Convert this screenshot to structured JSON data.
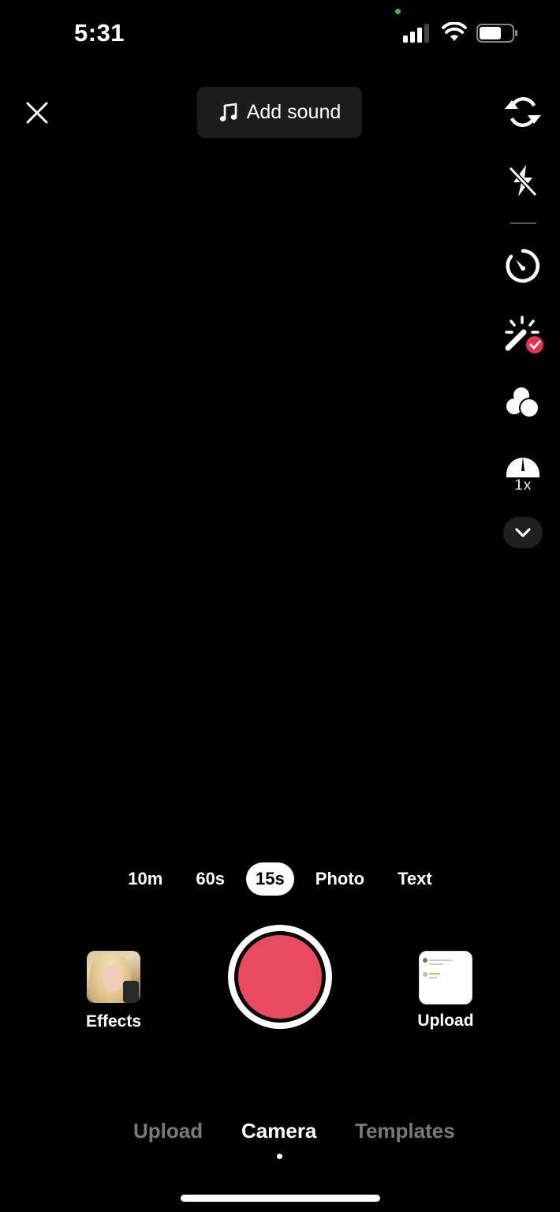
{
  "status_bar": {
    "time": "5:31",
    "icons": [
      "camera-in-use-indicator",
      "cellular-signal-icon",
      "wifi-icon",
      "battery-icon"
    ]
  },
  "top_bar": {
    "close_icon": "close-icon",
    "add_sound": {
      "icon": "music-note-icon",
      "label": "Add sound"
    }
  },
  "right_rail": {
    "items": [
      {
        "name": "flip-camera",
        "icon": "flip-camera-icon"
      },
      {
        "name": "flash-off",
        "icon": "flash-off-icon"
      },
      {
        "name": "timer",
        "icon": "timer-icon"
      },
      {
        "name": "beauty-enhance",
        "icon": "magic-wand-icon",
        "badge": "check",
        "badge_color": "#e8334d"
      },
      {
        "name": "filters",
        "icon": "filters-icon"
      },
      {
        "name": "speed",
        "icon": "speed-gauge-icon",
        "value": "1x"
      },
      {
        "name": "expand-more",
        "icon": "chevron-down-icon"
      }
    ]
  },
  "modes": {
    "items": [
      "10m",
      "60s",
      "15s",
      "Photo",
      "Text"
    ],
    "selected": "15s"
  },
  "capture": {
    "effects_label": "Effects",
    "upload_label": "Upload",
    "record_color": "#e84a5f"
  },
  "bottom_tabs": {
    "items": [
      "Upload",
      "Camera",
      "Templates"
    ],
    "selected": "Camera"
  }
}
